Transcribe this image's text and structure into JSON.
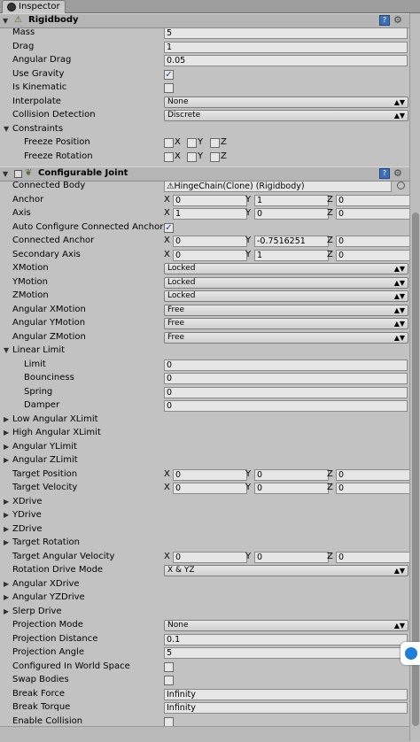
{
  "tab": {
    "title": "Inspector"
  },
  "rigidbody": {
    "title": "Rigidbody",
    "mass": {
      "label": "Mass",
      "value": "5"
    },
    "drag": {
      "label": "Drag",
      "value": "1"
    },
    "angular_drag": {
      "label": "Angular Drag",
      "value": "0.05"
    },
    "use_gravity": {
      "label": "Use Gravity",
      "checked": true
    },
    "is_kinematic": {
      "label": "Is Kinematic",
      "checked": false
    },
    "interpolate": {
      "label": "Interpolate",
      "value": "None"
    },
    "collision_detection": {
      "label": "Collision Detection",
      "value": "Discrete"
    },
    "constraints": {
      "label": "Constraints"
    },
    "freeze_position": {
      "label": "Freeze Position"
    },
    "freeze_rotation": {
      "label": "Freeze Rotation"
    },
    "axes": {
      "x": "X",
      "y": "Y",
      "z": "Z"
    }
  },
  "joint": {
    "title": "Configurable Joint",
    "connected_body": {
      "label": "Connected Body",
      "value": "HingeChain(Clone) (Rigidbody)"
    },
    "anchor": {
      "label": "Anchor",
      "x": "0",
      "y": "1",
      "z": "0"
    },
    "axis": {
      "label": "Axis",
      "x": "1",
      "y": "0",
      "z": "0"
    },
    "auto_configure": {
      "label": "Auto Configure Connected Anchor",
      "checked": true
    },
    "connected_anchor": {
      "label": "Connected Anchor",
      "x": "0",
      "y": "-0.7516251",
      "z": "0"
    },
    "secondary_axis": {
      "label": "Secondary Axis",
      "x": "0",
      "y": "1",
      "z": "0"
    },
    "x_motion": {
      "label": "XMotion",
      "value": "Locked"
    },
    "y_motion": {
      "label": "YMotion",
      "value": "Locked"
    },
    "z_motion": {
      "label": "ZMotion",
      "value": "Locked"
    },
    "ang_x_motion": {
      "label": "Angular XMotion",
      "value": "Free"
    },
    "ang_y_motion": {
      "label": "Angular YMotion",
      "value": "Free"
    },
    "ang_z_motion": {
      "label": "Angular ZMotion",
      "value": "Free"
    },
    "linear_limit": {
      "label": "Linear Limit"
    },
    "limit": {
      "label": "Limit",
      "value": "0"
    },
    "bounciness": {
      "label": "Bounciness",
      "value": "0"
    },
    "spring": {
      "label": "Spring",
      "value": "0"
    },
    "damper": {
      "label": "Damper",
      "value": "0"
    },
    "low_ang_x_limit": {
      "label": "Low Angular XLimit"
    },
    "high_ang_x_limit": {
      "label": "High Angular XLimit"
    },
    "ang_y_limit": {
      "label": "Angular YLimit"
    },
    "ang_z_limit": {
      "label": "Angular ZLimit"
    },
    "target_position": {
      "label": "Target Position",
      "x": "0",
      "y": "0",
      "z": "0"
    },
    "target_velocity": {
      "label": "Target Velocity",
      "x": "0",
      "y": "0",
      "z": "0"
    },
    "x_drive": {
      "label": "XDrive"
    },
    "y_drive": {
      "label": "YDrive"
    },
    "z_drive": {
      "label": "ZDrive"
    },
    "target_rotation": {
      "label": "Target Rotation"
    },
    "target_ang_velocity": {
      "label": "Target Angular Velocity",
      "x": "0",
      "y": "0",
      "z": "0"
    },
    "rotation_drive_mode": {
      "label": "Rotation Drive Mode",
      "value": "X & YZ"
    },
    "ang_x_drive": {
      "label": "Angular XDrive"
    },
    "ang_yz_drive": {
      "label": "Angular YZDrive"
    },
    "slerp_drive": {
      "label": "Slerp Drive"
    },
    "projection_mode": {
      "label": "Projection Mode",
      "value": "None"
    },
    "projection_distance": {
      "label": "Projection Distance",
      "value": "0.1"
    },
    "projection_angle": {
      "label": "Projection Angle",
      "value": "5"
    },
    "world_space": {
      "label": "Configured In World Space",
      "checked": false
    },
    "swap_bodies": {
      "label": "Swap Bodies",
      "checked": false
    },
    "break_force": {
      "label": "Break Force",
      "value": "Infinity"
    },
    "break_torque": {
      "label": "Break Torque",
      "value": "Infinity"
    },
    "enable_collision": {
      "label": "Enable Collision",
      "checked": false
    }
  }
}
